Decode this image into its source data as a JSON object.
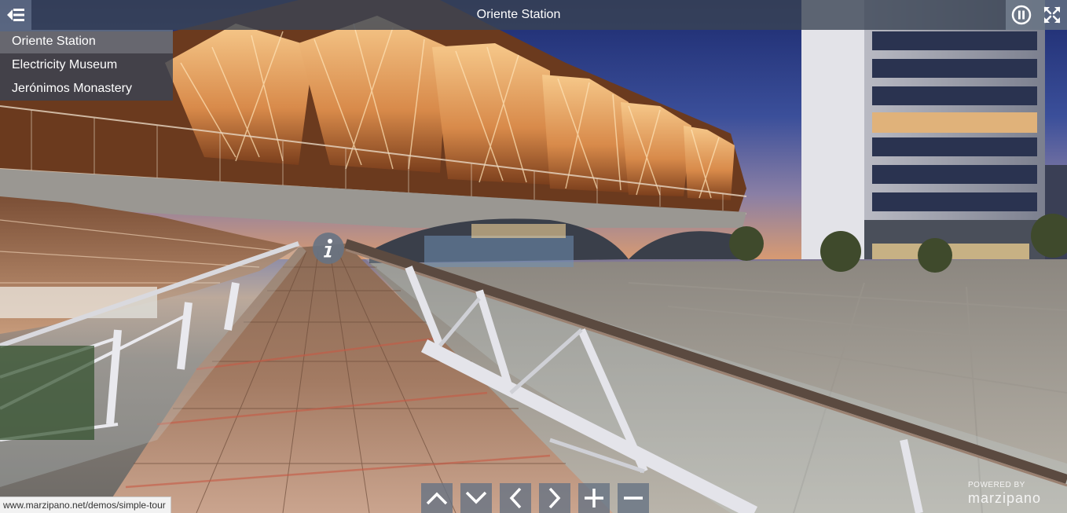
{
  "title": "Oriente Station",
  "scenes": [
    {
      "label": "Oriente Station",
      "current": true
    },
    {
      "label": "Electricity Museum",
      "current": false
    },
    {
      "label": "Jerónimos Monastery",
      "current": false
    }
  ],
  "icons": {
    "scene_list_toggle": "menu-collapse-left-icon",
    "autorotate": "pause-circle-icon",
    "fullscreen": "fullscreen-expand-icon",
    "info": "info-icon",
    "view_up": "chevron-up-icon",
    "view_down": "chevron-down-icon",
    "view_left": "chevron-left-icon",
    "view_right": "chevron-right-icon",
    "zoom_in": "plus-icon",
    "zoom_out": "minus-icon"
  },
  "status_url": "www.marzipano.net/demos/simple-tour",
  "powered_by": {
    "line1": "POWERED BY",
    "brand": "marzipano"
  },
  "colors": {
    "bar_dark": "#3a4454",
    "bar_light": "#677383"
  }
}
